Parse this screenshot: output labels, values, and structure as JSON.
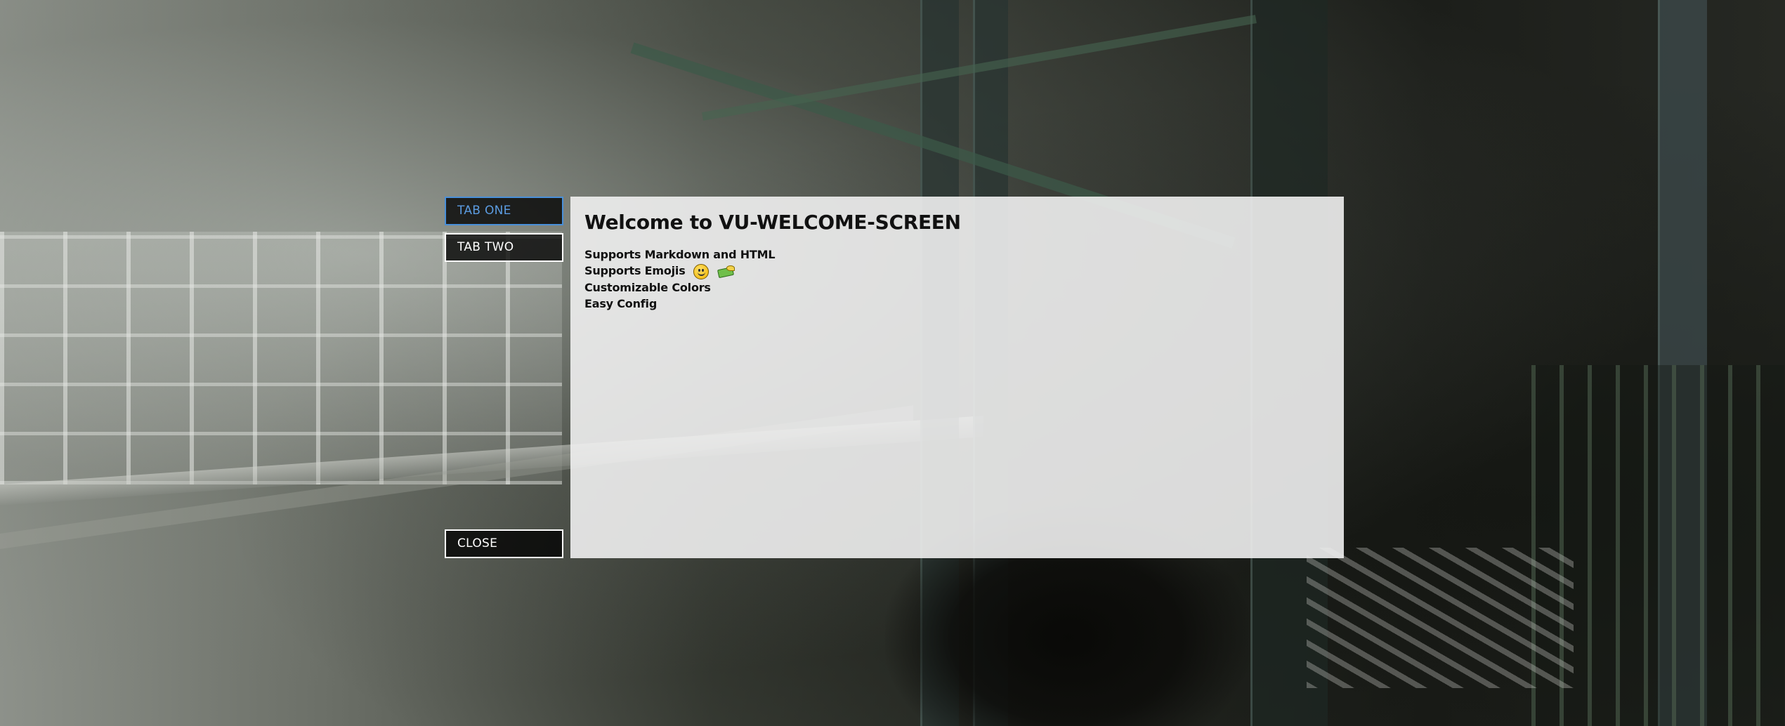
{
  "tabs": [
    {
      "label": "TAB ONE",
      "active": true
    },
    {
      "label": "TAB TWO",
      "active": false
    }
  ],
  "close_label": "CLOSE",
  "content": {
    "title": "Welcome to VU-WELCOME-SCREEN",
    "features": [
      {
        "text": "Supports Markdown and HTML"
      },
      {
        "text": "Supports Emojis",
        "emojis": [
          "smiley-emoji",
          "money-with-wings-emoji"
        ]
      },
      {
        "text": "Customizable Colors"
      },
      {
        "text": "Easy Config"
      }
    ]
  },
  "colors": {
    "active_tab_accent": "#4a90d9",
    "button_border": "#ffffff",
    "button_background": "#000000",
    "panel_background": "#f0f0f0",
    "text": "#111111"
  }
}
